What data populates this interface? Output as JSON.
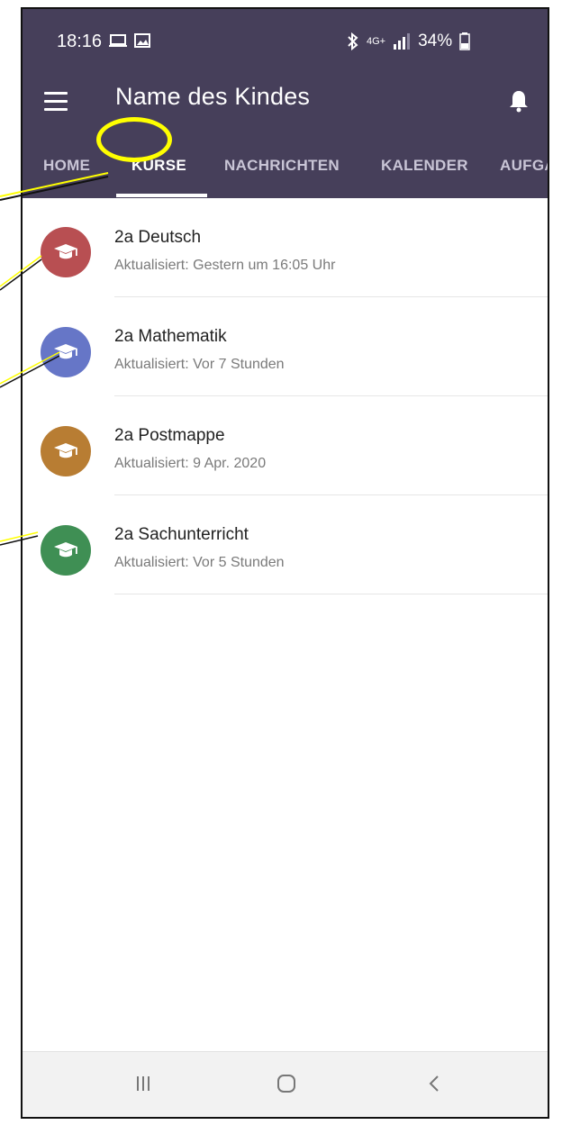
{
  "status_bar": {
    "time": "18:16",
    "signal": "4G+",
    "battery": "34%"
  },
  "toolbar": {
    "title": "Name des Kindes",
    "menu_icon": "hamburger-menu-icon",
    "bell_icon": "bell-icon"
  },
  "tabs": [
    {
      "label": "HOME",
      "active": false
    },
    {
      "label": "KURSE",
      "active": true
    },
    {
      "label": "NACHRICHTEN",
      "active": false
    },
    {
      "label": "KALENDER",
      "active": false
    },
    {
      "label": "AUFGA",
      "active": false
    }
  ],
  "courses": [
    {
      "name": "2a Deutsch",
      "updated": "Aktualisiert: Gestern um 16:05 Uhr",
      "color": "#b84f52",
      "icon": "graduation-cap-icon"
    },
    {
      "name": "2a Mathematik",
      "updated": "Aktualisiert: Vor 7 Stunden",
      "color": "#6676c7",
      "icon": "graduation-cap-icon"
    },
    {
      "name": "2a Postmappe",
      "updated": "Aktualisiert: 9 Apr. 2020",
      "color": "#b87d33",
      "icon": "graduation-cap-icon"
    },
    {
      "name": "2a Sachunterricht",
      "updated": "Aktualisiert: Vor 5 Stunden",
      "color": "#3f8f54",
      "icon": "graduation-cap-icon"
    }
  ],
  "colors": {
    "appbar": "#463f5a",
    "highlight": "#ffff00"
  }
}
